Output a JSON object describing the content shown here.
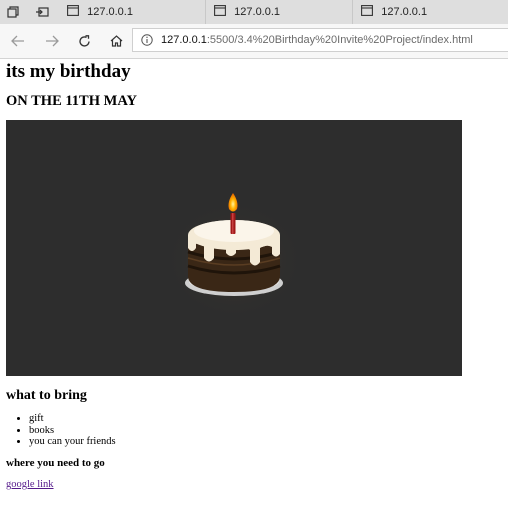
{
  "browser": {
    "tabs": [
      {
        "title": "127.0.0.1"
      },
      {
        "title": "127.0.0.1"
      },
      {
        "title": "127.0.0.1"
      }
    ],
    "address": {
      "host": "127.0.0.1",
      "path": ":5500/3.4%20Birthday%20Invite%20Project/index.html"
    }
  },
  "page": {
    "title": "its my birthday",
    "date_heading": "ON THE 11TH MAY",
    "bring_heading": "what to bring",
    "bring_items": [
      "gift",
      "books",
      "you can your friends"
    ],
    "location_heading": "where you need to go",
    "link_text": "google link"
  },
  "colors": {
    "hero_background": "#2d2d2d",
    "visited_link": "#551a8b"
  }
}
